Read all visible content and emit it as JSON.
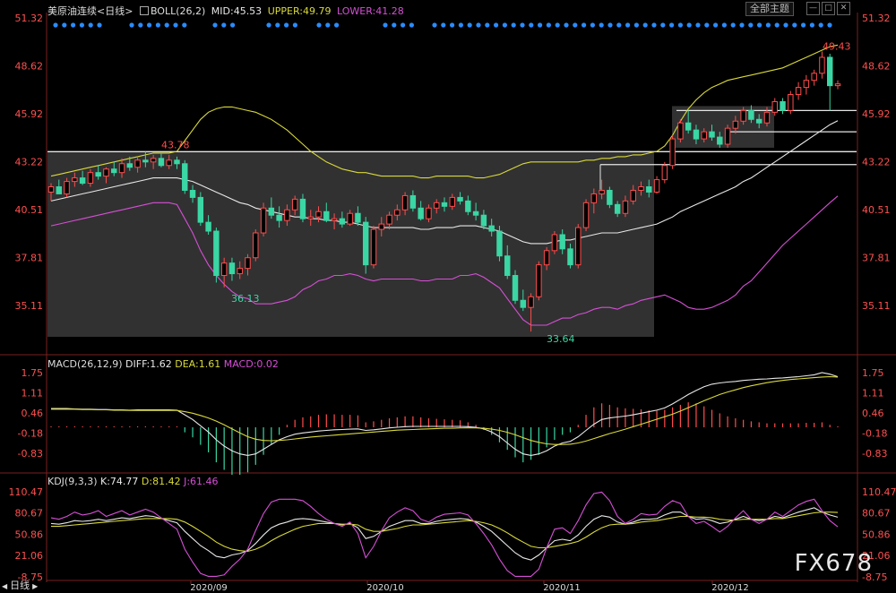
{
  "header": {
    "symbol": "美原油连续",
    "period": "<日线>",
    "indicator": "BOLL(26,2)",
    "mid": "MID:45.53",
    "upper": "UPPER:49.79",
    "lower": "LOWER:41.28",
    "all_indicators_button": "全部主题",
    "win_buttons": [
      "—",
      "□",
      "✕"
    ]
  },
  "colors": {
    "up": "#ff4d4d",
    "down": "#3ad6a4",
    "mid_line": "#e8e8e8",
    "upper_line": "#d9d93a",
    "lower_line": "#d64fd6",
    "macd_dea": "#d9d93a",
    "kdj_j": "#d64fd6",
    "price_label_up": "#ff4d4d",
    "price_label_down": "#3ad6a4",
    "axis_text": "#ff5050",
    "accent": "#2a8cff"
  },
  "price_axis": [
    "51.32",
    "48.62",
    "45.92",
    "43.22",
    "40.51",
    "37.81",
    "35.11"
  ],
  "macd_header": {
    "name": "MACD(26,12,9)",
    "diff": "DIFF:1.62",
    "dea": "DEA:1.61",
    "macd": "MACD:0.02"
  },
  "macd_axis": [
    "1.75",
    "1.11",
    "0.46",
    "-0.18",
    "-0.83"
  ],
  "kdj_header": {
    "name": "KDJ(9,3,3)",
    "k": "K:74.77",
    "d": "D:81.42",
    "j": "J:61.46"
  },
  "kdj_axis": [
    "110.47",
    "80.67",
    "50.86",
    "21.06",
    "-8.75"
  ],
  "x_labels": [
    "2020/09",
    "2020/10",
    "2020/11",
    "2020/12"
  ],
  "annotations": {
    "high_left": "43.78",
    "low_left": "36.13",
    "low_bottom": "33.64",
    "high_right": "49.43"
  },
  "bottom_tab": "日线",
  "watermark": "FX678",
  "chart_data": {
    "type": "candlestick",
    "ylim": [
      33.0,
      51.32
    ],
    "candles_ohlc": [
      [
        41.5,
        42.0,
        41.0,
        41.8
      ],
      [
        41.8,
        42.2,
        41.4,
        41.4
      ],
      [
        41.4,
        42.3,
        41.2,
        42.1
      ],
      [
        42.1,
        42.6,
        41.8,
        42.3
      ],
      [
        42.3,
        42.7,
        41.9,
        42.0
      ],
      [
        42.0,
        42.8,
        41.8,
        42.6
      ],
      [
        42.6,
        43.0,
        42.2,
        42.4
      ],
      [
        42.4,
        42.9,
        42.0,
        42.8
      ],
      [
        42.8,
        43.2,
        42.4,
        42.6
      ],
      [
        42.6,
        43.4,
        42.3,
        43.1
      ],
      [
        43.1,
        43.5,
        42.7,
        42.9
      ],
      [
        42.9,
        43.5,
        42.6,
        43.3
      ],
      [
        43.3,
        43.78,
        42.9,
        43.2
      ],
      [
        43.2,
        43.6,
        42.8,
        43.4
      ],
      [
        43.4,
        43.7,
        42.9,
        43.0
      ],
      [
        43.0,
        43.6,
        42.8,
        43.3
      ],
      [
        43.3,
        43.5,
        42.8,
        43.1
      ],
      [
        43.1,
        43.3,
        41.4,
        41.6
      ],
      [
        41.6,
        41.9,
        40.9,
        41.2
      ],
      [
        41.2,
        41.5,
        39.6,
        39.8
      ],
      [
        39.8,
        40.2,
        39.1,
        39.3
      ],
      [
        39.3,
        39.5,
        36.4,
        36.8
      ],
      [
        36.8,
        37.8,
        36.13,
        37.5
      ],
      [
        37.5,
        37.8,
        36.5,
        36.9
      ],
      [
        36.9,
        37.6,
        36.6,
        37.2
      ],
      [
        37.2,
        38.0,
        36.8,
        37.8
      ],
      [
        37.8,
        39.4,
        37.6,
        39.2
      ],
      [
        39.2,
        40.9,
        39.0,
        40.6
      ],
      [
        40.6,
        41.2,
        40.0,
        40.2
      ],
      [
        40.2,
        40.7,
        39.5,
        39.9
      ],
      [
        39.9,
        40.8,
        39.6,
        40.5
      ],
      [
        40.5,
        41.3,
        40.2,
        41.1
      ],
      [
        41.1,
        41.4,
        39.8,
        40.0
      ],
      [
        40.0,
        40.5,
        39.6,
        40.1
      ],
      [
        40.1,
        40.7,
        39.8,
        40.4
      ],
      [
        40.4,
        40.9,
        39.8,
        39.9
      ],
      [
        39.9,
        40.3,
        39.4,
        40.0
      ],
      [
        40.0,
        40.4,
        39.5,
        39.7
      ],
      [
        39.7,
        40.5,
        39.6,
        40.3
      ],
      [
        40.3,
        40.7,
        39.6,
        39.8
      ],
      [
        39.8,
        40.1,
        36.9,
        37.4
      ],
      [
        37.4,
        39.6,
        37.2,
        39.4
      ],
      [
        39.4,
        40.1,
        39.0,
        39.7
      ],
      [
        39.7,
        40.4,
        39.4,
        40.2
      ],
      [
        40.2,
        40.8,
        39.9,
        40.5
      ],
      [
        40.5,
        41.5,
        40.2,
        41.3
      ],
      [
        41.3,
        41.6,
        40.4,
        40.6
      ],
      [
        40.6,
        41.0,
        39.9,
        40.0
      ],
      [
        40.0,
        40.8,
        39.8,
        40.6
      ],
      [
        40.6,
        41.1,
        40.3,
        40.9
      ],
      [
        40.9,
        41.2,
        40.4,
        40.7
      ],
      [
        40.7,
        41.4,
        40.5,
        41.2
      ],
      [
        41.2,
        41.5,
        40.8,
        41.0
      ],
      [
        41.0,
        41.3,
        40.2,
        40.4
      ],
      [
        40.4,
        40.9,
        39.9,
        40.2
      ],
      [
        40.2,
        40.5,
        39.4,
        39.6
      ],
      [
        39.6,
        40.0,
        39.0,
        39.3
      ],
      [
        39.3,
        39.6,
        37.6,
        37.9
      ],
      [
        37.9,
        38.5,
        36.6,
        36.8
      ],
      [
        36.8,
        37.1,
        35.2,
        35.4
      ],
      [
        35.4,
        36.0,
        34.8,
        35.0
      ],
      [
        35.0,
        35.8,
        33.64,
        35.6
      ],
      [
        35.6,
        37.6,
        35.4,
        37.4
      ],
      [
        37.4,
        38.4,
        37.1,
        38.2
      ],
      [
        38.2,
        39.3,
        38.0,
        39.1
      ],
      [
        39.1,
        39.4,
        38.0,
        38.3
      ],
      [
        38.3,
        38.6,
        37.2,
        37.4
      ],
      [
        37.4,
        39.7,
        37.2,
        39.5
      ],
      [
        39.5,
        41.1,
        39.3,
        40.9
      ],
      [
        40.9,
        41.7,
        40.3,
        41.4
      ],
      [
        41.4,
        42.2,
        41.1,
        41.6
      ],
      [
        41.6,
        41.8,
        40.6,
        40.8
      ],
      [
        40.8,
        41.0,
        40.1,
        40.3
      ],
      [
        40.3,
        41.3,
        40.1,
        41.0
      ],
      [
        41.0,
        41.9,
        40.8,
        41.6
      ],
      [
        41.6,
        42.1,
        41.3,
        41.8
      ],
      [
        41.8,
        42.2,
        41.2,
        41.5
      ],
      [
        41.5,
        42.4,
        41.4,
        42.2
      ],
      [
        42.2,
        43.2,
        42.0,
        43.0
      ],
      [
        43.0,
        44.7,
        42.8,
        44.5
      ],
      [
        44.5,
        45.6,
        44.3,
        45.4
      ],
      [
        45.4,
        46.1,
        44.8,
        45.0
      ],
      [
        45.0,
        45.3,
        44.2,
        44.5
      ],
      [
        44.5,
        45.1,
        44.3,
        44.9
      ],
      [
        44.9,
        45.3,
        44.4,
        44.6
      ],
      [
        44.6,
        44.9,
        44.0,
        44.2
      ],
      [
        44.2,
        45.3,
        44.0,
        45.1
      ],
      [
        45.1,
        45.8,
        44.8,
        45.5
      ],
      [
        45.5,
        46.3,
        45.3,
        46.1
      ],
      [
        46.1,
        46.4,
        45.4,
        45.6
      ],
      [
        45.6,
        45.9,
        45.1,
        45.4
      ],
      [
        45.4,
        46.3,
        45.2,
        46.0
      ],
      [
        46.0,
        46.8,
        45.8,
        46.6
      ],
      [
        46.6,
        46.8,
        45.9,
        46.1
      ],
      [
        46.1,
        47.2,
        45.9,
        47.0
      ],
      [
        47.0,
        47.7,
        46.7,
        47.4
      ],
      [
        47.4,
        48.1,
        47.0,
        47.8
      ],
      [
        47.8,
        48.4,
        47.5,
        48.2
      ],
      [
        48.2,
        49.43,
        47.9,
        49.1
      ],
      [
        49.1,
        49.3,
        46.1,
        47.5
      ],
      [
        47.5,
        47.8,
        47.3,
        47.6
      ]
    ],
    "boll_mid": [
      41.0,
      41.1,
      41.2,
      41.3,
      41.4,
      41.5,
      41.6,
      41.7,
      41.8,
      41.9,
      42.0,
      42.1,
      42.2,
      42.3,
      42.3,
      42.3,
      42.3,
      42.2,
      42.1,
      41.9,
      41.7,
      41.5,
      41.3,
      41.1,
      40.9,
      40.8,
      40.6,
      40.5,
      40.4,
      40.3,
      40.2,
      40.1,
      40.1,
      40.0,
      40.0,
      39.9,
      39.9,
      39.8,
      39.8,
      39.7,
      39.6,
      39.5,
      39.5,
      39.5,
      39.5,
      39.5,
      39.5,
      39.4,
      39.4,
      39.5,
      39.5,
      39.5,
      39.6,
      39.6,
      39.6,
      39.5,
      39.4,
      39.3,
      39.1,
      38.9,
      38.7,
      38.6,
      38.6,
      38.6,
      38.7,
      38.8,
      38.8,
      38.9,
      39.0,
      39.1,
      39.2,
      39.2,
      39.2,
      39.3,
      39.4,
      39.5,
      39.6,
      39.7,
      39.9,
      40.1,
      40.4,
      40.6,
      40.8,
      41.0,
      41.2,
      41.4,
      41.6,
      41.8,
      42.1,
      42.3,
      42.6,
      42.9,
      43.2,
      43.5,
      43.8,
      44.1,
      44.4,
      44.7,
      45.0,
      45.3,
      45.53
    ],
    "boll_upper": [
      42.4,
      42.5,
      42.6,
      42.7,
      42.8,
      42.9,
      43.0,
      43.1,
      43.2,
      43.3,
      43.4,
      43.5,
      43.6,
      43.7,
      43.7,
      43.7,
      43.8,
      44.4,
      45.0,
      45.6,
      46.0,
      46.2,
      46.3,
      46.3,
      46.2,
      46.1,
      46.0,
      45.8,
      45.6,
      45.3,
      45.0,
      44.6,
      44.2,
      43.8,
      43.5,
      43.2,
      43.0,
      42.8,
      42.7,
      42.6,
      42.6,
      42.5,
      42.4,
      42.4,
      42.4,
      42.4,
      42.4,
      42.3,
      42.3,
      42.4,
      42.4,
      42.4,
      42.4,
      42.4,
      42.3,
      42.3,
      42.4,
      42.5,
      42.7,
      42.9,
      43.1,
      43.2,
      43.2,
      43.2,
      43.2,
      43.2,
      43.2,
      43.2,
      43.3,
      43.3,
      43.4,
      43.4,
      43.5,
      43.5,
      43.6,
      43.6,
      43.7,
      43.8,
      44.1,
      44.7,
      45.5,
      46.2,
      46.7,
      47.1,
      47.4,
      47.6,
      47.8,
      47.9,
      48.0,
      48.1,
      48.2,
      48.3,
      48.4,
      48.5,
      48.7,
      48.9,
      49.1,
      49.3,
      49.5,
      49.7,
      49.79
    ],
    "boll_lower": [
      39.6,
      39.7,
      39.8,
      39.9,
      40.0,
      40.1,
      40.2,
      40.3,
      40.4,
      40.5,
      40.6,
      40.7,
      40.8,
      40.9,
      40.9,
      40.9,
      40.8,
      40.0,
      39.2,
      38.2,
      37.4,
      36.8,
      36.3,
      35.9,
      35.6,
      35.5,
      35.2,
      35.2,
      35.2,
      35.3,
      35.4,
      35.6,
      36.0,
      36.2,
      36.5,
      36.6,
      36.8,
      36.8,
      36.9,
      36.8,
      36.6,
      36.5,
      36.6,
      36.6,
      36.6,
      36.6,
      36.6,
      36.5,
      36.5,
      36.6,
      36.6,
      36.6,
      36.8,
      36.8,
      36.9,
      36.7,
      36.4,
      36.1,
      35.5,
      34.9,
      34.3,
      34.0,
      34.0,
      34.0,
      34.2,
      34.4,
      34.4,
      34.6,
      34.7,
      34.9,
      35.0,
      35.0,
      34.9,
      35.1,
      35.2,
      35.4,
      35.5,
      35.6,
      35.7,
      35.5,
      35.3,
      35.0,
      34.9,
      34.9,
      35.0,
      35.2,
      35.4,
      35.7,
      36.2,
      36.5,
      37.0,
      37.5,
      38.0,
      38.5,
      38.9,
      39.3,
      39.7,
      40.1,
      40.5,
      40.9,
      41.28
    ],
    "horizontal_levels": [
      43.78,
      46.1,
      44.9,
      43.7,
      43.05
    ],
    "macd_ylim": [
      -1.3,
      1.85
    ],
    "macd_hist": [
      0.02,
      0.02,
      0.02,
      0.02,
      0.02,
      0.02,
      0.02,
      0.02,
      0.02,
      0.02,
      0.02,
      0.02,
      0.02,
      0.02,
      0.02,
      0.02,
      0.02,
      -0.1,
      -0.2,
      -0.35,
      -0.5,
      -0.7,
      -0.85,
      -0.95,
      -0.95,
      -0.9,
      -0.75,
      -0.55,
      -0.35,
      -0.15,
      0.05,
      0.15,
      0.2,
      0.22,
      0.25,
      0.26,
      0.26,
      0.25,
      0.25,
      0.24,
      0.1,
      0.12,
      0.15,
      0.18,
      0.2,
      0.22,
      0.22,
      0.2,
      0.18,
      0.17,
      0.16,
      0.15,
      0.14,
      0.1,
      0.05,
      -0.05,
      -0.15,
      -0.3,
      -0.45,
      -0.6,
      -0.7,
      -0.65,
      -0.55,
      -0.4,
      -0.25,
      -0.15,
      -0.1,
      0.05,
      0.25,
      0.4,
      0.48,
      0.45,
      0.4,
      0.38,
      0.37,
      0.36,
      0.34,
      0.33,
      0.35,
      0.4,
      0.45,
      0.5,
      0.48,
      0.42,
      0.35,
      0.28,
      0.22,
      0.18,
      0.15,
      0.12,
      0.1,
      0.08,
      0.08,
      0.08,
      0.08,
      0.08,
      0.09,
      0.09,
      0.1,
      0.05,
      0.02
    ],
    "macd_diff": [
      0.6,
      0.6,
      0.6,
      0.59,
      0.58,
      0.58,
      0.57,
      0.57,
      0.56,
      0.56,
      0.55,
      0.56,
      0.56,
      0.56,
      0.56,
      0.56,
      0.55,
      0.4,
      0.25,
      0.05,
      -0.15,
      -0.4,
      -0.6,
      -0.75,
      -0.85,
      -0.9,
      -0.85,
      -0.7,
      -0.55,
      -0.4,
      -0.3,
      -0.22,
      -0.18,
      -0.15,
      -0.12,
      -0.1,
      -0.08,
      -0.07,
      -0.06,
      -0.05,
      -0.1,
      -0.08,
      -0.05,
      -0.02,
      0.0,
      0.02,
      0.03,
      0.03,
      0.03,
      0.03,
      0.03,
      0.03,
      0.03,
      0.02,
      0.0,
      -0.05,
      -0.15,
      -0.3,
      -0.5,
      -0.7,
      -0.85,
      -0.9,
      -0.85,
      -0.75,
      -0.6,
      -0.5,
      -0.45,
      -0.3,
      -0.1,
      0.1,
      0.25,
      0.3,
      0.33,
      0.36,
      0.4,
      0.45,
      0.5,
      0.55,
      0.62,
      0.75,
      0.9,
      1.05,
      1.18,
      1.3,
      1.38,
      1.42,
      1.45,
      1.47,
      1.5,
      1.52,
      1.54,
      1.55,
      1.57,
      1.58,
      1.6,
      1.62,
      1.65,
      1.68,
      1.75,
      1.7,
      1.62
    ],
    "macd_dea": [
      0.58,
      0.58,
      0.58,
      0.58,
      0.57,
      0.57,
      0.56,
      0.56,
      0.55,
      0.55,
      0.54,
      0.54,
      0.54,
      0.54,
      0.54,
      0.54,
      0.54,
      0.5,
      0.45,
      0.38,
      0.3,
      0.2,
      0.08,
      -0.05,
      -0.18,
      -0.3,
      -0.38,
      -0.42,
      -0.43,
      -0.42,
      -0.4,
      -0.37,
      -0.34,
      -0.31,
      -0.29,
      -0.27,
      -0.25,
      -0.23,
      -0.21,
      -0.19,
      -0.17,
      -0.15,
      -0.13,
      -0.11,
      -0.09,
      -0.08,
      -0.07,
      -0.06,
      -0.05,
      -0.04,
      -0.03,
      -0.03,
      -0.02,
      -0.02,
      -0.02,
      -0.03,
      -0.06,
      -0.1,
      -0.16,
      -0.24,
      -0.33,
      -0.42,
      -0.48,
      -0.53,
      -0.55,
      -0.55,
      -0.54,
      -0.5,
      -0.44,
      -0.36,
      -0.28,
      -0.2,
      -0.13,
      -0.06,
      0.02,
      0.1,
      0.18,
      0.26,
      0.34,
      0.42,
      0.52,
      0.63,
      0.74,
      0.85,
      0.95,
      1.05,
      1.13,
      1.2,
      1.27,
      1.33,
      1.38,
      1.43,
      1.47,
      1.5,
      1.53,
      1.55,
      1.57,
      1.59,
      1.61,
      1.62,
      1.61
    ],
    "kdj_ylim": [
      -8.75,
      110.47
    ],
    "kdj_k": [
      66,
      65,
      67,
      70,
      69,
      70,
      72,
      70,
      72,
      74,
      73,
      75,
      77,
      76,
      73,
      70,
      67,
      55,
      45,
      35,
      28,
      20,
      18,
      22,
      24,
      28,
      38,
      50,
      60,
      65,
      68,
      72,
      73,
      72,
      70,
      68,
      66,
      64,
      66,
      60,
      45,
      48,
      55,
      62,
      66,
      70,
      70,
      66,
      66,
      69,
      71,
      72,
      73,
      72,
      68,
      62,
      55,
      45,
      35,
      25,
      18,
      15,
      22,
      32,
      42,
      44,
      42,
      50,
      62,
      72,
      77,
      75,
      68,
      65,
      68,
      72,
      72,
      73,
      78,
      82,
      82,
      76,
      72,
      73,
      70,
      66,
      68,
      72,
      76,
      72,
      70,
      72,
      76,
      74,
      78,
      82,
      85,
      88,
      82,
      78,
      74.77
    ],
    "kdj_d": [
      62,
      62,
      63,
      64,
      65,
      66,
      67,
      68,
      69,
      70,
      71,
      72,
      73,
      73,
      73,
      73,
      72,
      68,
      62,
      55,
      48,
      40,
      34,
      30,
      28,
      27,
      30,
      35,
      42,
      48,
      53,
      58,
      62,
      64,
      66,
      66,
      66,
      65,
      65,
      64,
      58,
      55,
      55,
      57,
      59,
      62,
      64,
      64,
      65,
      66,
      67,
      68,
      69,
      70,
      69,
      67,
      64,
      59,
      53,
      46,
      40,
      34,
      32,
      32,
      34,
      36,
      38,
      41,
      47,
      54,
      60,
      64,
      65,
      65,
      66,
      68,
      69,
      70,
      72,
      74,
      76,
      76,
      75,
      75,
      74,
      72,
      71,
      71,
      72,
      72,
      72,
      72,
      73,
      73,
      75,
      77,
      79,
      81,
      82,
      82,
      81.42
    ],
    "kdj_j": [
      74,
      72,
      76,
      82,
      78,
      80,
      84,
      76,
      80,
      84,
      78,
      82,
      86,
      82,
      74,
      66,
      58,
      30,
      12,
      -4,
      -8,
      -8,
      -6,
      6,
      16,
      30,
      56,
      80,
      96,
      100,
      100,
      100,
      98,
      90,
      80,
      72,
      66,
      62,
      68,
      52,
      18,
      34,
      56,
      74,
      82,
      88,
      84,
      72,
      68,
      75,
      79,
      80,
      81,
      78,
      66,
      52,
      36,
      16,
      0,
      -8,
      -8,
      -8,
      2,
      32,
      58,
      60,
      52,
      70,
      92,
      108,
      110,
      98,
      76,
      66,
      72,
      80,
      78,
      79,
      90,
      98,
      94,
      76,
      66,
      69,
      62,
      54,
      62,
      74,
      84,
      72,
      66,
      72,
      82,
      76,
      84,
      92,
      97,
      100,
      84,
      70,
      61.46
    ]
  }
}
